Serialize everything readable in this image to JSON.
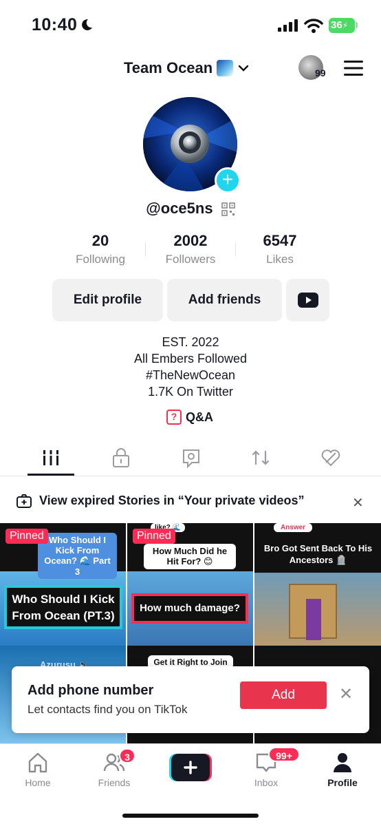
{
  "status_bar": {
    "time": "10:40",
    "battery": "36"
  },
  "header": {
    "account_name": "Team Ocean",
    "notification_count": "99"
  },
  "profile": {
    "username": "@oce5ns",
    "stats": [
      {
        "value": "20",
        "label": "Following"
      },
      {
        "value": "2002",
        "label": "Followers"
      },
      {
        "value": "6547",
        "label": "Likes"
      }
    ],
    "buttons": {
      "edit": "Edit profile",
      "add_friends": "Add friends"
    },
    "bio": [
      "EST. 2022",
      "All Embers Followed",
      "#TheNewOcean",
      "1.7K On Twitter"
    ],
    "qa_label": "Q&A"
  },
  "tabs": [
    {
      "icon": "grid-icon",
      "active": true
    },
    {
      "icon": "lock-icon",
      "active": false
    },
    {
      "icon": "tag-icon",
      "active": false
    },
    {
      "icon": "repost-icon",
      "active": false
    },
    {
      "icon": "liked-icon",
      "active": false
    }
  ],
  "stories_banner": {
    "text": "View expired Stories in “Your private videos”"
  },
  "videos": [
    {
      "pinned_label": "Pinned",
      "bubble": "Who Should I Kick From Ocean? 🌊 Part 3",
      "caption": "Who Should I Kick From Ocean (PT.3)",
      "extra": "Azurusu 🔈"
    },
    {
      "pinned_label": "Pinned",
      "bubble_small": "like? 🌊",
      "bubble": "How Much Did he Hit For? 😊",
      "caption": "How much damage?",
      "extra": "Get it Right to Join"
    },
    {
      "bubble_small": "Answer",
      "top_text": "Bro Got Sent Back To His Ancestors 🪦"
    }
  ],
  "popup": {
    "title": "Add phone number",
    "subtitle": "Let contacts find you on TikTok",
    "button": "Add"
  },
  "nav": {
    "items": [
      {
        "label": "Home",
        "icon": "home-icon"
      },
      {
        "label": "Friends",
        "icon": "friends-icon",
        "badge": "3"
      },
      {
        "label": "",
        "icon": "create-icon"
      },
      {
        "label": "Inbox",
        "icon": "inbox-icon",
        "badge": "99+"
      },
      {
        "label": "Profile",
        "icon": "profile-icon"
      }
    ]
  },
  "colors": {
    "accent": "#fe2c55",
    "secondary": "#20d5ec",
    "button_bg": "#f1f1f2",
    "text_muted": "#8a8b91"
  }
}
